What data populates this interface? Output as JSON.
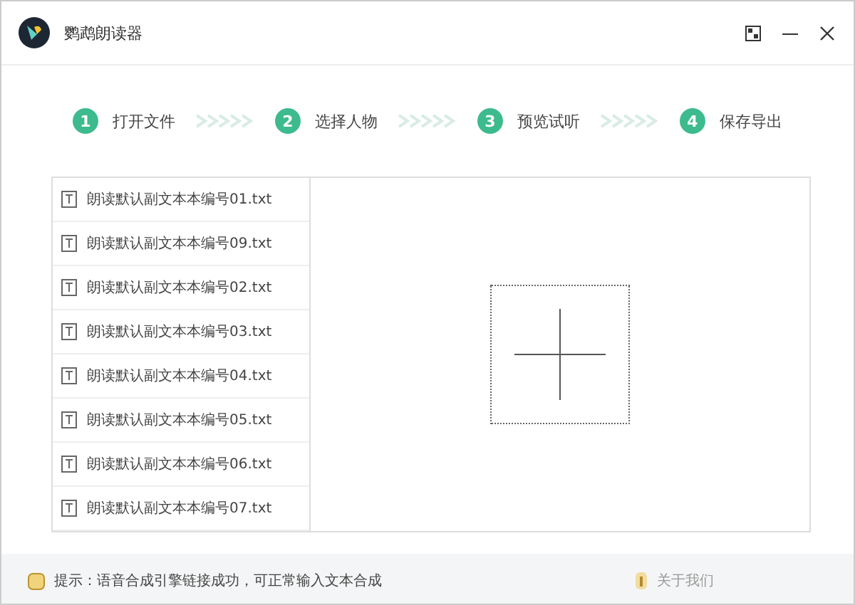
{
  "window": {
    "title": "鹦鹉朗读器"
  },
  "steps": [
    {
      "number": "1",
      "label": "打开文件"
    },
    {
      "number": "2",
      "label": "选择人物"
    },
    {
      "number": "3",
      "label": "预览试听"
    },
    {
      "number": "4",
      "label": "保存导出"
    }
  ],
  "files": [
    "朗读默认副文本本编号01.txt",
    "朗读默认副文本本编号09.txt",
    "朗读默认副文本本编号02.txt",
    "朗读默认副文本本编号03.txt",
    "朗读默认副文本本编号04.txt",
    "朗读默认副文本本编号05.txt",
    "朗读默认副文本本编号06.txt",
    "朗读默认副文本本编号07.txt"
  ],
  "status_bar": {
    "message": "提示：语音合成引擎链接成功，可正常输入文本合成",
    "about": "关于我们"
  }
}
